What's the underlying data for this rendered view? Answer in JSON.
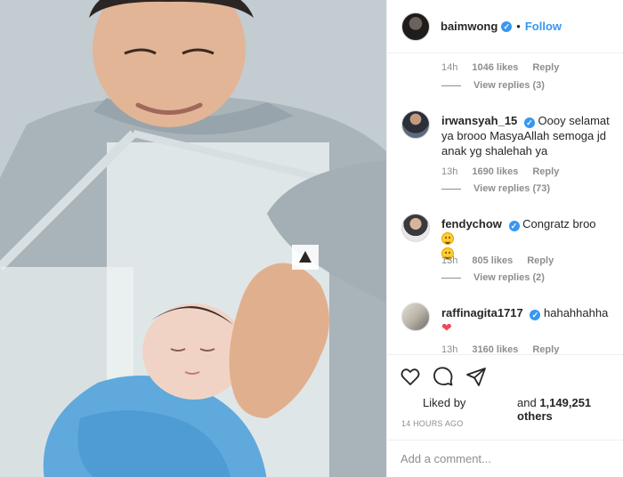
{
  "header": {
    "username": "baimwong",
    "separator": "•",
    "follow_label": "Follow"
  },
  "comments": [
    {
      "time": "14h",
      "likes": "1046 likes",
      "reply_label": "Reply",
      "view_replies": "View replies (3)"
    },
    {
      "username": "irwansyah_15",
      "text": "Oooy selamat ya brooo MasyaAllah semoga jd anak yg shalehah ya",
      "time": "13h",
      "likes": "1690 likes",
      "reply_label": "Reply",
      "view_replies": "View replies (73)"
    },
    {
      "username": "fendychow",
      "text": "Congratz broo",
      "time": "13h",
      "likes": "805 likes",
      "reply_label": "Reply",
      "view_replies": "View replies (2)"
    },
    {
      "username": "raffinagita1717",
      "text": "hahahhahha",
      "time": "13h",
      "likes": "3160 likes",
      "reply_label": "Reply"
    }
  ],
  "icons": {
    "like": "heart-outline-icon",
    "comment": "speech-bubble-icon",
    "share": "paper-plane-icon",
    "verified": "verified-badge-icon"
  },
  "post": {
    "liked_by_label": "Liked by",
    "and_label": "and",
    "others_count": "1,149,251 others",
    "timestamp": "14 HOURS AGO"
  },
  "add_comment": {
    "placeholder": "Add a comment..."
  },
  "colors": {
    "link_blue": "#3897f0",
    "verified_blue": "#3897f0",
    "secondary_text": "#8e8e8e",
    "heart_red": "#ed4956"
  }
}
